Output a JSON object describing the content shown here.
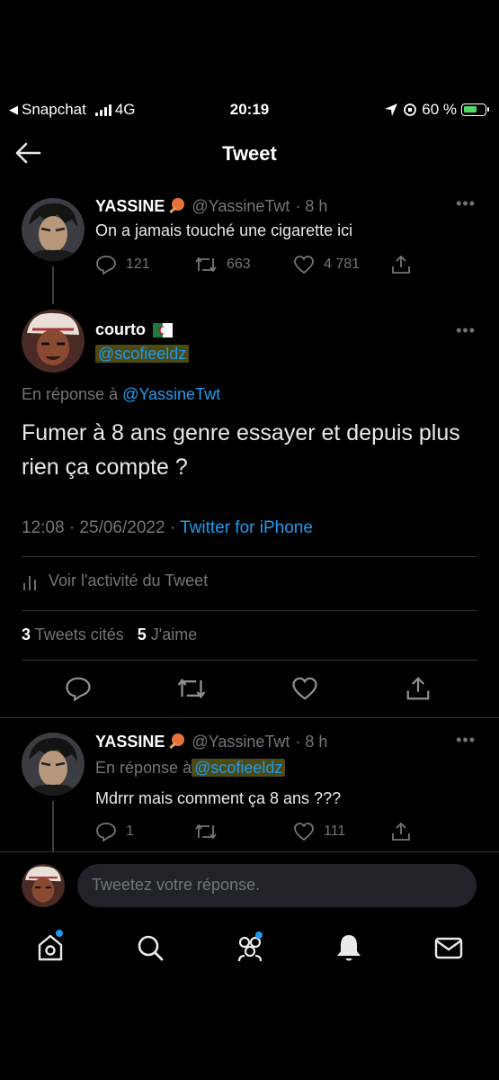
{
  "status_bar": {
    "back_app": "Snapchat",
    "network": "4G",
    "time": "20:19",
    "battery": "60 %"
  },
  "header": {
    "title": "Tweet"
  },
  "parent_tweet": {
    "name": "YASSINE",
    "handle": "@YassineTwt",
    "time": "· 8 h",
    "text": "On a jamais touché une cigarette ici",
    "replies": "121",
    "retweets": "663",
    "likes": "4 781"
  },
  "main_tweet": {
    "name": "courto",
    "handle": "@scofieeldz",
    "reply_prefix": "En réponse à",
    "reply_to": "@YassineTwt",
    "text": "Fumer à 8 ans genre essayer et depuis plus rien ça compte ?",
    "timestamp": "12:08 · 25/06/2022 ·",
    "source": "Twitter for iPhone",
    "activity": "Voir l'activité du Tweet",
    "quotes_count": "3",
    "quotes_label": "Tweets cités",
    "likes_count": "5",
    "likes_label": "J'aime"
  },
  "reply_tweet": {
    "name": "YASSINE",
    "handle": "@YassineTwt",
    "time": "· 8 h",
    "reply_prefix": "En réponse à",
    "reply_to": "@scofieeldz",
    "text": "Mdrrr mais comment ça 8 ans ???",
    "replies": "1",
    "likes": "111"
  },
  "compose": {
    "placeholder": "Tweetez votre réponse."
  },
  "icons": {
    "back": "arrow-left-icon",
    "more": "more-icon",
    "reply": "reply-icon",
    "retweet": "retweet-icon",
    "like": "heart-icon",
    "share": "share-icon",
    "tabs": [
      "home-icon",
      "search-icon",
      "communities-icon",
      "notifications-icon",
      "messages-icon"
    ]
  },
  "colors": {
    "accent": "#1d9bf0",
    "background": "#000000",
    "muted": "#71767b",
    "highlight": "#4d4a14"
  }
}
